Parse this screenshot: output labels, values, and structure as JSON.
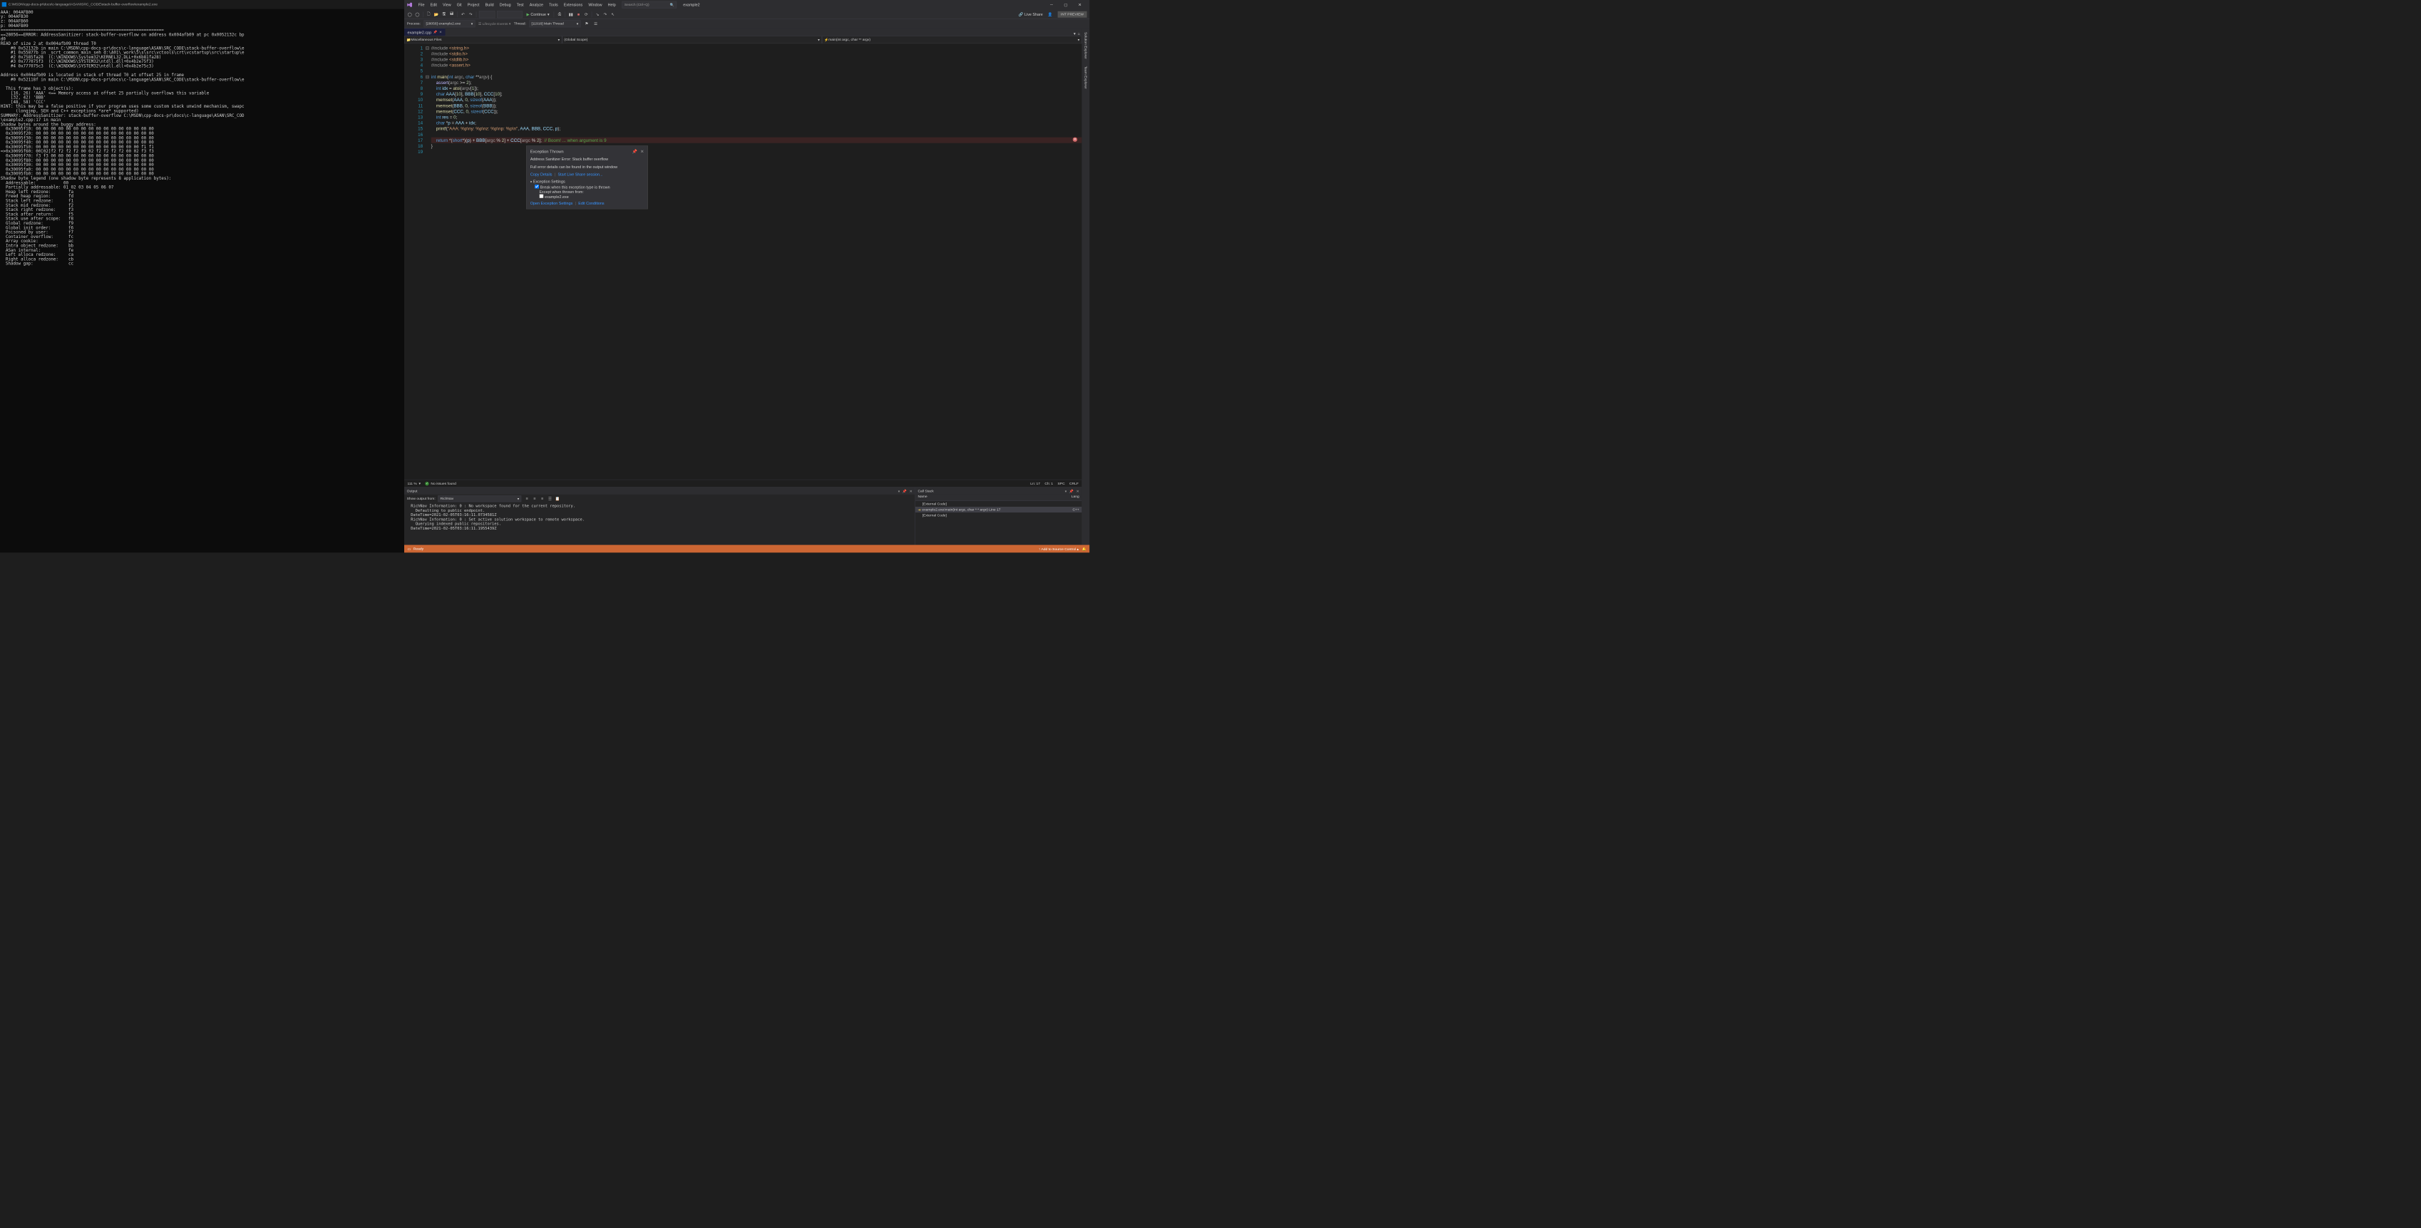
{
  "console": {
    "title": "C:\\MSDN\\cpp-docs-pr\\docs\\c-language\\ASAN\\SRC_CODE\\stack-buffer-overflow\\example2.exe",
    "body": "AAA: 004AFB00\ny: 004AFB30\nz: 004AFB60\np: 004AFB09\n=================================================================\n==28056==ERROR: AddressSanitizer: stack-buffer-overflow on address 0x004afb09 at pc 0x0052132c bp \nd0\nREAD of size 2 at 0x004afb09 thread T0\n    #0 0x52132b in main C:\\MSDN\\cpp-docs-pr\\docs\\c-language\\ASAN\\SRC_CODE\\stack-buffer-overflow\\e\n    #1 0x55877b in _scrt_common_main_seh d:\\A01\\_work\\5\\s\\src\\vctools\\crt\\vcstartup\\src\\startup\\e\n    #2 0x7585fa28  (C:\\WINDOWS\\System32\\KERNEL32.DLL+0x6b81fa28)\n    #3 0x777075f3  (C:\\WINDOWS\\SYSTEM32\\ntdll.dll+0x4b2e75f3)\n    #4 0x777075c3  (C:\\WINDOWS\\SYSTEM32\\ntdll.dll+0x4b2e75c3)\n\nAddress 0x004afb09 is located in stack of thread T0 at offset 25 in frame\n    #0 0x52118f in main C:\\MSDN\\cpp-docs-pr\\docs\\c-language\\ASAN\\SRC_CODE\\stack-buffer-overflow\\e\n\n  This frame has 3 object(s):\n    [16, 26) 'AAA' <== Memory access at offset 25 partially overflows this variable\n    [32, 42) 'BBB'\n    [48, 58) 'CCC'\nHINT: this may be a false positive if your program uses some custom stack unwind mechanism, swapc\n      (longjmp, SEH and C++ exceptions *are* supported)\nSUMMARY: AddressSanitizer: stack-buffer-overflow C:\\MSDN\\cpp-docs-pr\\docs\\c-language\\ASAN\\SRC_COD\n\\example2.cpp:17 in main\nShadow bytes around the buggy address:\n  0x30095f10: 00 00 00 00 00 00 00 00 00 00 00 00 00 00 00 00\n  0x30095f20: 00 00 00 00 00 00 00 00 00 00 00 00 00 00 00 00\n  0x30095f30: 00 00 00 00 00 00 00 00 00 00 00 00 00 00 00 00\n  0x30095f40: 00 00 00 00 00 00 00 00 00 00 00 00 00 00 00 00\n  0x30095f50: 00 00 00 00 00 00 00 00 00 00 00 00 00 00 f1 f1\n=>0x30095f60: 00[02]f2 f2 f2 f2 00 02 f2 f2 f2 f2 00 02 f3 f3\n  0x30095f70: f3 f3 00 00 00 00 00 00 00 00 00 00 00 00 00 00\n  0x30095f80: 00 00 00 00 00 00 00 00 00 00 00 00 00 00 00 00\n  0x30095f90: 00 00 00 00 00 00 00 00 00 00 00 00 00 00 00 00\n  0x30095fa0: 00 00 00 00 00 00 00 00 00 00 00 00 00 00 00 00\n  0x30095fb0: 00 00 00 00 00 00 00 00 00 00 00 00 00 00 00 00\nShadow byte legend (one shadow byte represents 8 application bytes):\n  Addressable:           00\n  Partially addressable: 01 02 03 04 05 06 07\n  Heap left redzone:       fa\n  Freed heap region:       fd\n  Stack left redzone:      f1\n  Stack mid redzone:       f2\n  Stack right redzone:     f3\n  Stack after return:      f5\n  Stack use after scope:   f8\n  Global redzone:          f9\n  Global init order:       f6\n  Poisoned by user:        f7\n  Container overflow:      fc\n  Array cookie:            ac\n  Intra object redzone:    bb\n  ASan internal:           fe\n  Left alloca redzone:     ca\n  Right alloca redzone:    cb\n  Shadow gap:              cc"
  },
  "menu": [
    "File",
    "Edit",
    "View",
    "Git",
    "Project",
    "Build",
    "Debug",
    "Test",
    "Analyze",
    "Tools",
    "Extensions",
    "Window",
    "Help"
  ],
  "search": "Search (Ctrl+Q)",
  "app_title": "example2",
  "toolbar": {
    "continue": "Continue",
    "liveshare": "Live Share",
    "intprev": "INT PREVIEW"
  },
  "debug": {
    "process_label": "Process:",
    "process": "[28056] example2.exe",
    "lifecycle": "Lifecycle Events",
    "thread_label": "Thread:",
    "thread": "[11916] Main Thread"
  },
  "tab": {
    "name": "example2.cpp"
  },
  "nav": {
    "scope1": "Miscellaneous Files",
    "scope2": "(Global Scope)",
    "scope3": "main(int argc, char ** argv)"
  },
  "lines": [
    "1",
    "2",
    "3",
    "4",
    "5",
    "6",
    "7",
    "8",
    "9",
    "10",
    "11",
    "12",
    "13",
    "14",
    "15",
    "16",
    "17",
    "18",
    "19"
  ],
  "popup": {
    "title": "Exception Thrown",
    "msg1": "Address Sanitizer Error: Stack buffer overflow",
    "msg2": "Full error details can be found in the output window",
    "copy": "Copy Details",
    "start": "Start Live Share session...",
    "settings": "Exception Settings",
    "break": "Break when this exception type is thrown",
    "except": "Except when thrown from:",
    "exe": "example2.exe",
    "open": "Open Exception Settings",
    "edit": "Edit Conditions"
  },
  "status": {
    "zoom": "111 %",
    "issues": "No issues found",
    "ln": "Ln: 17",
    "ch": "Ch: 1",
    "spc": "SPC",
    "crlf": "CRLF"
  },
  "output": {
    "title": "Output",
    "from": "Show output from:",
    "src": "RichNav",
    "body": "  RichNav Information: 0 : No workspace found for the current repository.\n    Defaulting to public endpoint.\n  DateTime=2021-02-05T03:16:11.0734581Z\n  RichNav Information: 0 : Set active solution workspace to remote workspace.\n    Querying indexed public repositories.\n  DateTime=2021-02-05T03:16:11.1955439Z"
  },
  "callstack": {
    "title": "Call Stack",
    "cols": {
      "name": "Name",
      "lang": "Lang"
    },
    "rows": [
      {
        "name": "[External Code]",
        "lang": ""
      },
      {
        "name": "example2.exe!main(int argc, char * * argv) Line 17",
        "lang": "C++",
        "cur": true
      },
      {
        "name": "[External Code]",
        "lang": ""
      }
    ]
  },
  "side": [
    "Solution Explorer",
    "Team Explorer"
  ],
  "statusbar": {
    "ready": "Ready",
    "add": "Add to Source Control"
  }
}
